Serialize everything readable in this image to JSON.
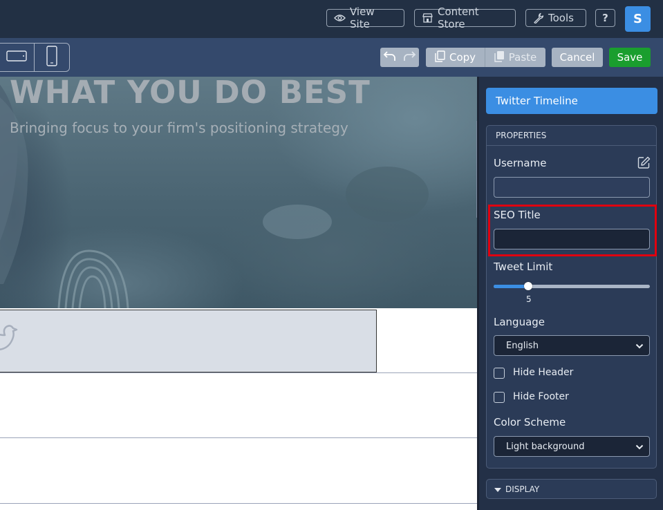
{
  "topbar": {
    "view_site": "View Site",
    "content_store": "Content Store",
    "tools": "Tools",
    "help": "?",
    "avatar_initial": "S"
  },
  "toolbar": {
    "copy": "Copy",
    "paste": "Paste",
    "cancel": "Cancel",
    "save": "Save",
    "colors": {
      "save": "#1a9e2e",
      "cancel": "#a7b3c2",
      "accent": "#3b8ee3"
    }
  },
  "hero": {
    "title": "WHAT YOU DO BEST",
    "subtitle": "Bringing focus to your firm's positioning strategy"
  },
  "panel": {
    "component_title": "Twitter Timeline",
    "properties_header": "PROPERTIES",
    "username_label": "Username",
    "username_value": "",
    "seo_title_label": "SEO Title",
    "seo_title_value": "",
    "tweet_limit_label": "Tweet Limit",
    "tweet_limit_value": "5",
    "tweet_limit_fraction": 0.22,
    "language_label": "Language",
    "language_value": "English",
    "hide_header_label": "Hide Header",
    "hide_header_checked": false,
    "hide_footer_label": "Hide Footer",
    "hide_footer_checked": false,
    "color_scheme_label": "Color Scheme",
    "color_scheme_value": "Light background",
    "display_header": "DISPLAY"
  },
  "icons": [
    "eye-icon",
    "store-icon",
    "wrench-icon",
    "tablet-icon",
    "phone-icon",
    "undo-icon",
    "redo-icon",
    "copy-icon",
    "paste-icon",
    "edit-icon",
    "chevron-down-icon",
    "caret-down-icon",
    "twitter-bird-icon"
  ]
}
